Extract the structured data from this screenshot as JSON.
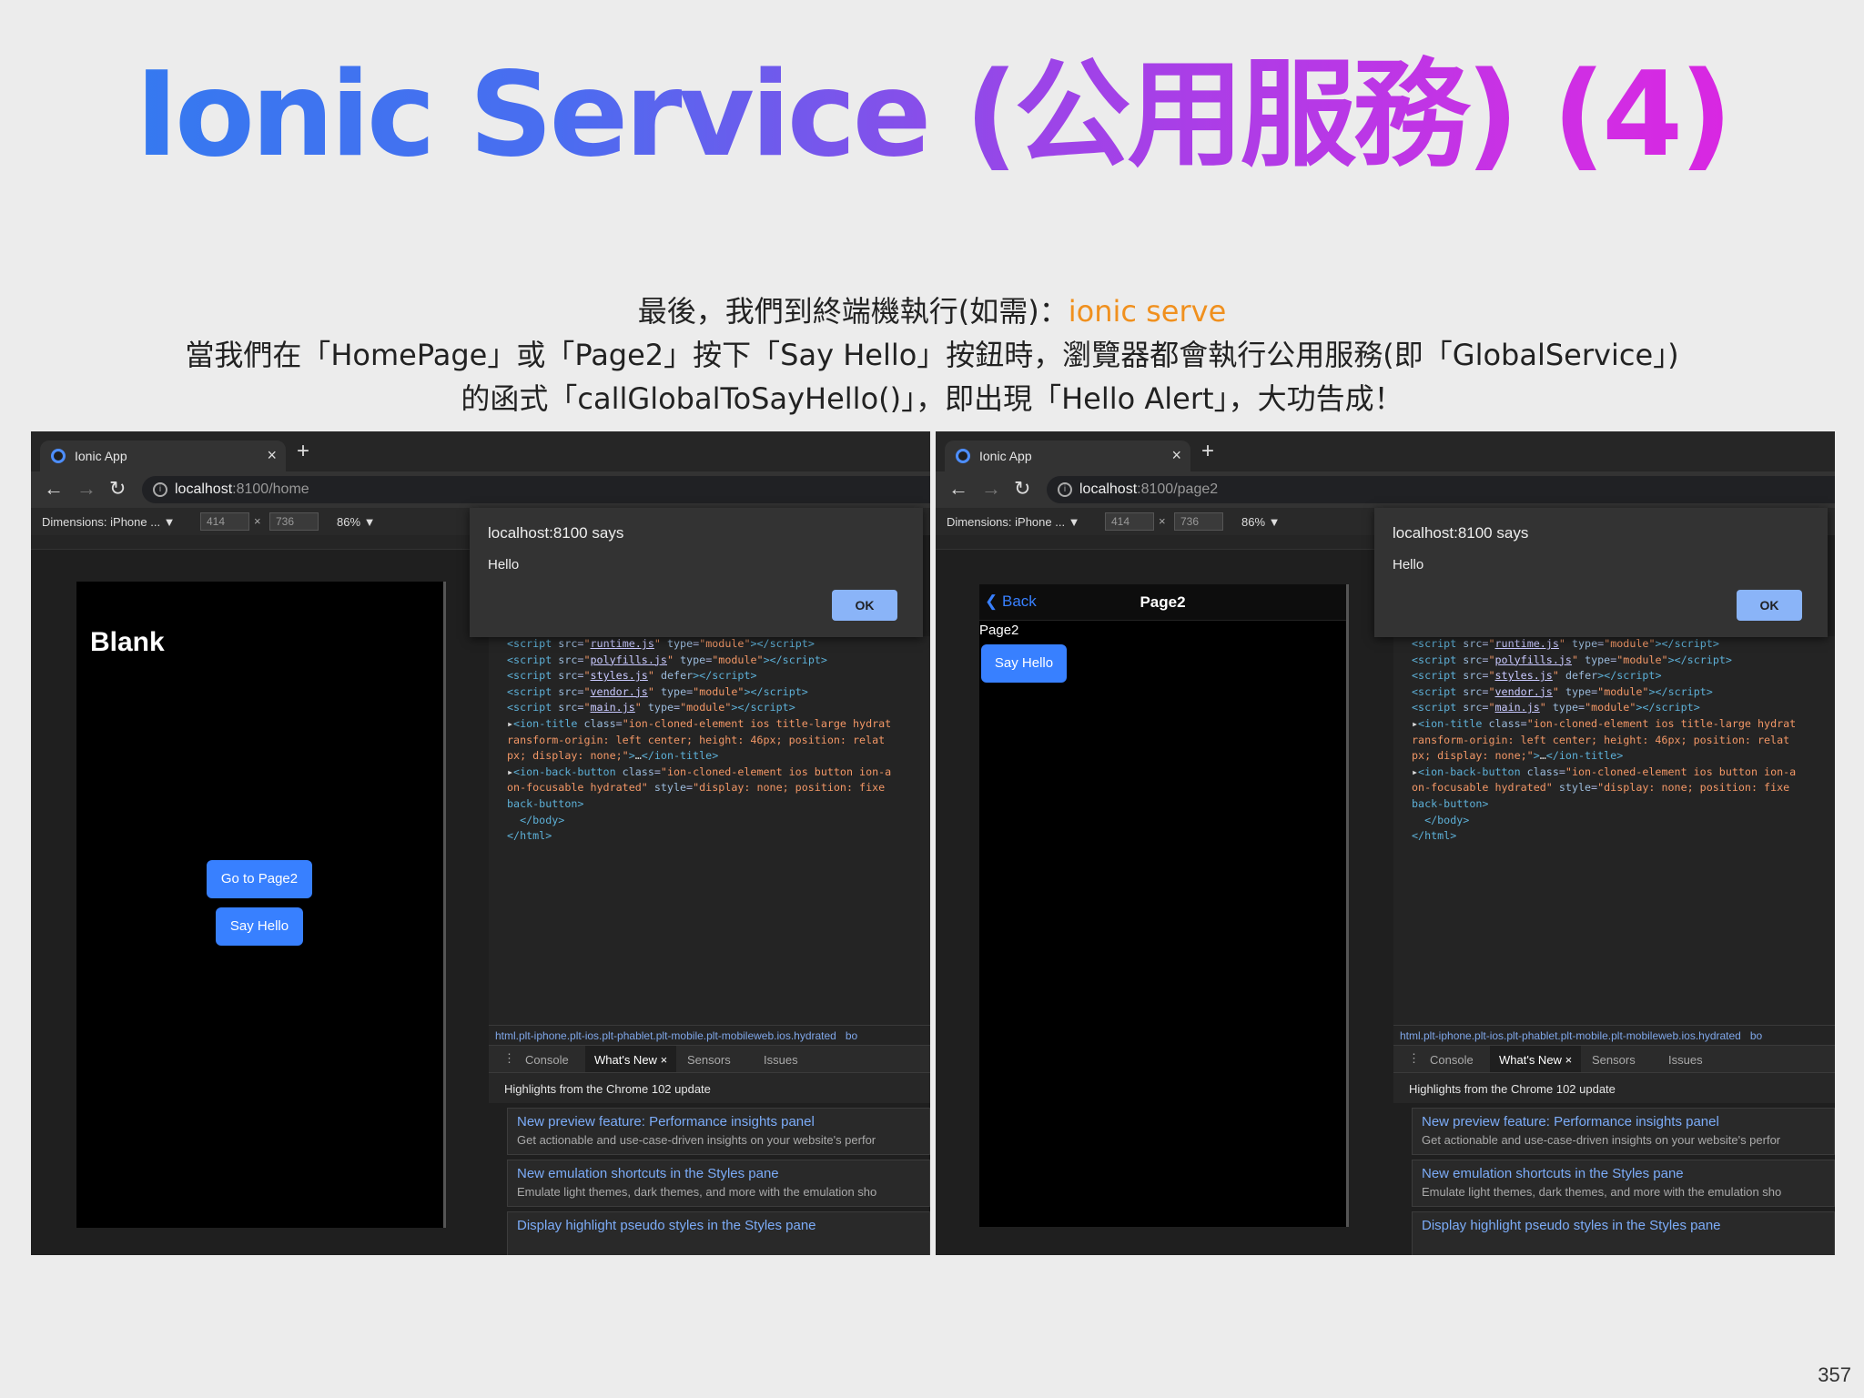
{
  "slide": {
    "title": "Ionic Service (公用服務) (4)",
    "line1_prefix": "最後，我們到終端機執行(如需)：",
    "line1_cmd": "ionic serve",
    "line2": "當我們在「HomePage」或「Page2」按下「Say Hello」按鈕時，瀏覽器都會執行公用服務(即「GlobalService」)",
    "line3": "的函式「callGlobalToSayHello()」，即出現「Hello Alert」，大功告成！",
    "page_number": "357"
  },
  "browser": {
    "tab_title": "Ionic App",
    "tab_close": "×",
    "new_tab": "+",
    "nav_back": "←",
    "nav_forward": "→",
    "nav_reload": "↻",
    "url_host": "localhost",
    "url_home_path": ":8100/home",
    "url_page2_path": ":8100/page2",
    "device_label": "Dimensions: iPhone ... ▼",
    "width": "414",
    "height": "736",
    "dim_x": "×",
    "zoom": "86% ▼"
  },
  "dialog": {
    "title": "localhost:8100 says",
    "message": "Hello",
    "ok": "OK"
  },
  "home": {
    "title": "Blank",
    "goto_btn": "Go to Page2",
    "hello_btn": "Say Hello"
  },
  "page2": {
    "back": "Back",
    "title": "Page2",
    "label": "Page2",
    "hello_btn": "Say Hello"
  },
  "devtools": {
    "crumbs": "html.plt-iphone.plt-ios.plt-phablet.plt-mobile.plt-mobileweb.ios.hydrated",
    "crumbs_tail": "bo",
    "tabs": [
      "Console",
      "What's New",
      "Sensors",
      "Issues"
    ],
    "tab_close": "×",
    "highlights": "Highlights from the Chrome 102 update",
    "cards": [
      {
        "title": "New preview feature: Performance insights panel",
        "desc": "Get actionable and use-case-driven insights on your website's perfor"
      },
      {
        "title": "New emulation shortcuts in the Styles pane",
        "desc": "Emulate light themes, dark themes, and more with the emulation sho"
      },
      {
        "title": "Display highlight pseudo styles in the Styles pane",
        "desc": ""
      }
    ]
  }
}
